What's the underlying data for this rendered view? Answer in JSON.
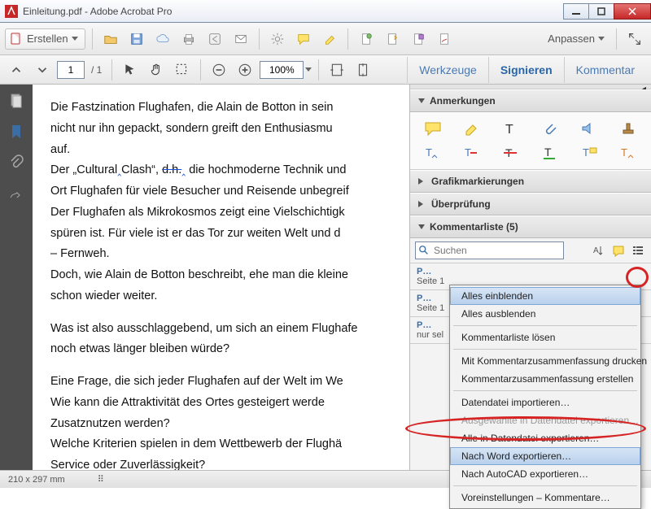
{
  "window": {
    "title": "Einleitung.pdf - Adobe Acrobat Pro"
  },
  "toolbar": {
    "create_label": "Erstellen",
    "adjust_label": "Anpassen"
  },
  "nav": {
    "page_value": "1",
    "page_count": "/ 1",
    "zoom_value": "100%"
  },
  "rightlinks": {
    "tools": "Werkzeuge",
    "sign": "Signieren",
    "comment": "Kommentar"
  },
  "panels": {
    "annotations": "Anmerkungen",
    "drawmarks": "Grafikmarkierungen",
    "review": "Überprüfung",
    "commentlist": "Kommentarliste (5)"
  },
  "search": {
    "placeholder": "Suchen"
  },
  "commentitems": [
    {
      "hd": "P…",
      "sub": "Seite 1"
    },
    {
      "hd": "P…",
      "sub": "Seite 1"
    },
    {
      "hd": "P…",
      "sub": "nur sel"
    }
  ],
  "ctx": {
    "show_all": "Alles einblenden",
    "hide_all": "Alles ausblenden",
    "detach": "Kommentarliste lösen",
    "print_summary": "Mit Kommentarzusammenfassung drucken",
    "make_summary": "Kommentarzusammenfassung erstellen",
    "import_data": "Datendatei importieren…",
    "export_sel": "Ausgewählte in Datendatei exportieren…",
    "export_all": "Alle in Datendatei exportieren…",
    "export_word": "Nach Word exportieren…",
    "export_autocad": "Nach AutoCAD exportieren…",
    "prefs": "Voreinstellungen – Kommentare…"
  },
  "status": {
    "dims": "210 x 297 mm"
  },
  "doc": {
    "p1": "Die Fastzination Flughafen, die Alain de Botton in sein",
    "p2": "nicht nur ihn gepackt, sondern greift den Enthusiasmu",
    "p3": "auf.",
    "p4a": "Der „Cultural",
    "p4b": "Clash“, ",
    "p4c": "d.h.",
    "p4d": " die hochmoderne Technik und",
    "p5": "Ort Flughafen für viele Besucher und Reisende unbegreif",
    "p6": "Der Flughafen als Mikrokosmos zeigt eine Vielschichtigk",
    "p7": "spüren ist. Für viele ist er das Tor zur weiten Welt und d",
    "p8": "– Fernweh.",
    "p9": "Doch, wie Alain de Botton beschreibt, ehe man die kleine",
    "p10": "schon wieder weiter.",
    "p11": "Was ist also ausschlaggebend, um sich an einem Flughafe",
    "p12": "noch etwas länger bleiben würde?",
    "p13": "Eine Frage, die sich jeder Flughafen auf der Welt im We",
    "p14": "Wie kann die Attraktivität des Ortes gesteigert werde",
    "p15": "Zusatznutzen werden?",
    "p16": "Welche Kriterien spielen in dem Wettbewerb der Flughä",
    "p17": "Service oder Zuverlässigkeit?"
  }
}
